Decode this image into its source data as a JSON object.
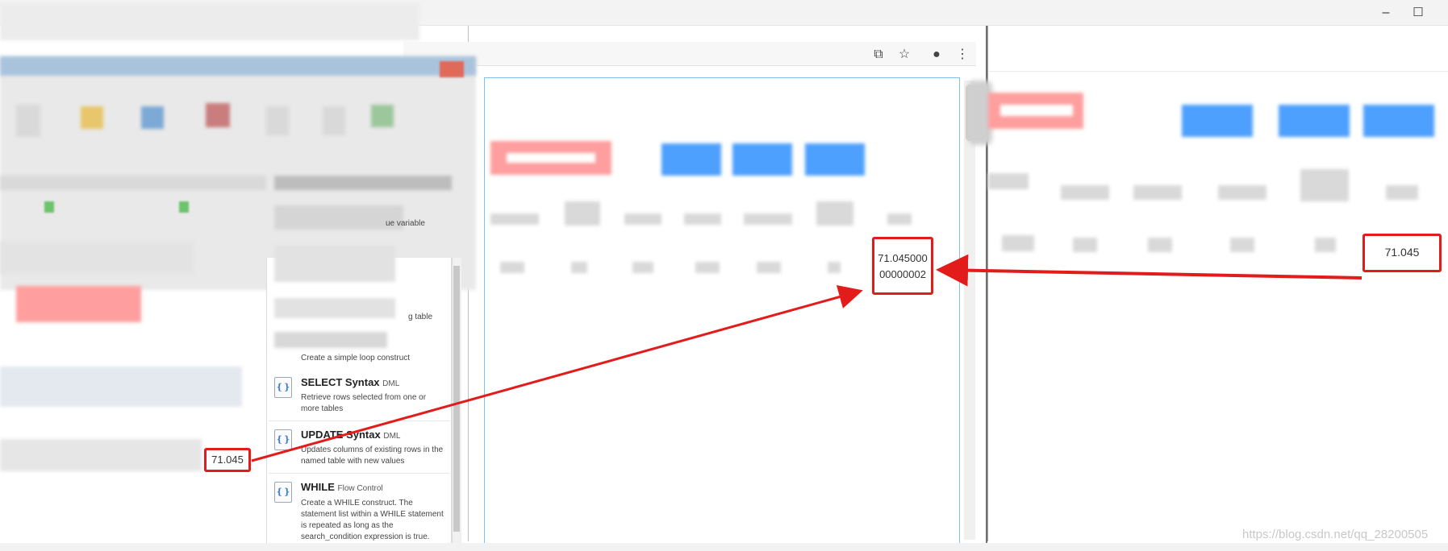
{
  "window_controls": {
    "minimize": "–",
    "maximize": "☐"
  },
  "toolbar_icons": [
    {
      "name": "translate-icon",
      "glyph": "⧉"
    },
    {
      "name": "star-icon",
      "glyph": "☆"
    },
    {
      "name": "account-icon",
      "glyph": "●"
    },
    {
      "name": "menu-icon",
      "glyph": "⋮"
    }
  ],
  "snippets": {
    "partial_1": "ue variable",
    "partial_2": "g table",
    "partial_3": "Create a simple loop construct",
    "items": [
      {
        "title": "SELECT Syntax",
        "tag": "DML",
        "desc": "Retrieve rows selected from one or more tables"
      },
      {
        "title": "UPDATE Syntax",
        "tag": "DML",
        "desc": "Updates columns of existing rows in the named table with new values"
      },
      {
        "title": "WHILE",
        "tag": "Flow Control",
        "desc": "Create a WHILE construct. The statement list within a WHILE statement is repeated as long as the search_condition expression is true."
      }
    ]
  },
  "values": {
    "left_value": "71.045",
    "middle_value_line1": "71.045000",
    "middle_value_line2": "00000002",
    "right_value": "71.045"
  },
  "colors": {
    "highlight": "#e21b1b",
    "blue_button": "#4ea0ff",
    "pink_button": "#ff9e9e"
  },
  "watermark": "https://blog.csdn.net/qq_28200505"
}
